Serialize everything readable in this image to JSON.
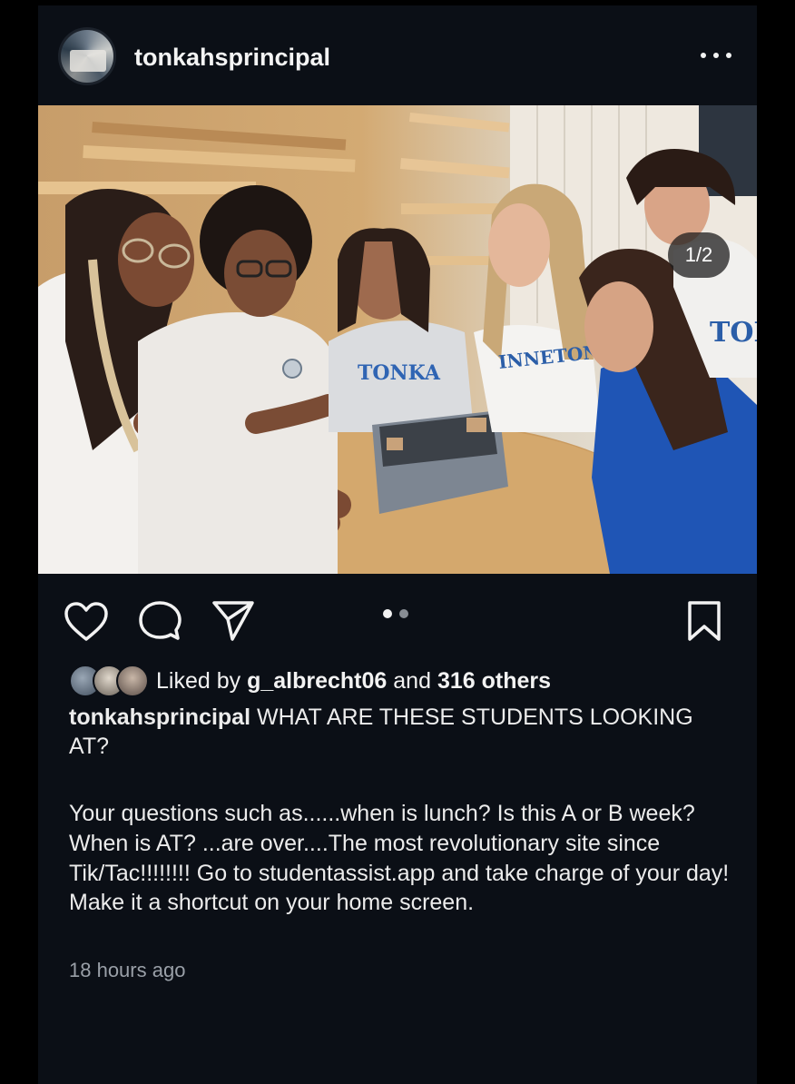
{
  "post": {
    "username": "tonkahsprincipal",
    "image_counter": "1/2",
    "carousel": {
      "total": 2,
      "active": 1
    },
    "liked_by_prefix": "Liked by",
    "liked_by_user": "g_albrecht06",
    "liked_by_joiner": "and",
    "liked_by_others": "316 others",
    "caption_user": "tonkahsprincipal",
    "caption_title": "WHAT ARE THESE STUDENTS LOOKING AT?",
    "caption_body": "Your questions such as......when is lunch? Is this A or B week?  When is AT? ...are over....The most revolutionary site since Tik/Tac!!!!!!!! Go to studentassist.app and take charge of your day!  Make it a shortcut on your home screen.",
    "timestamp": "18 hours ago",
    "shirt_text_1": "TONKA",
    "shirt_text_2": "INNETONKA",
    "shirt_text_3": "TON"
  },
  "icons": {
    "more": "more-horizontal-icon",
    "like": "heart-icon",
    "comment": "comment-bubble-icon",
    "share": "send-icon",
    "save": "bookmark-icon"
  },
  "colors": {
    "background": "#0b0f16",
    "text": "#f2f2f2",
    "muted": "#9aa0a8"
  }
}
